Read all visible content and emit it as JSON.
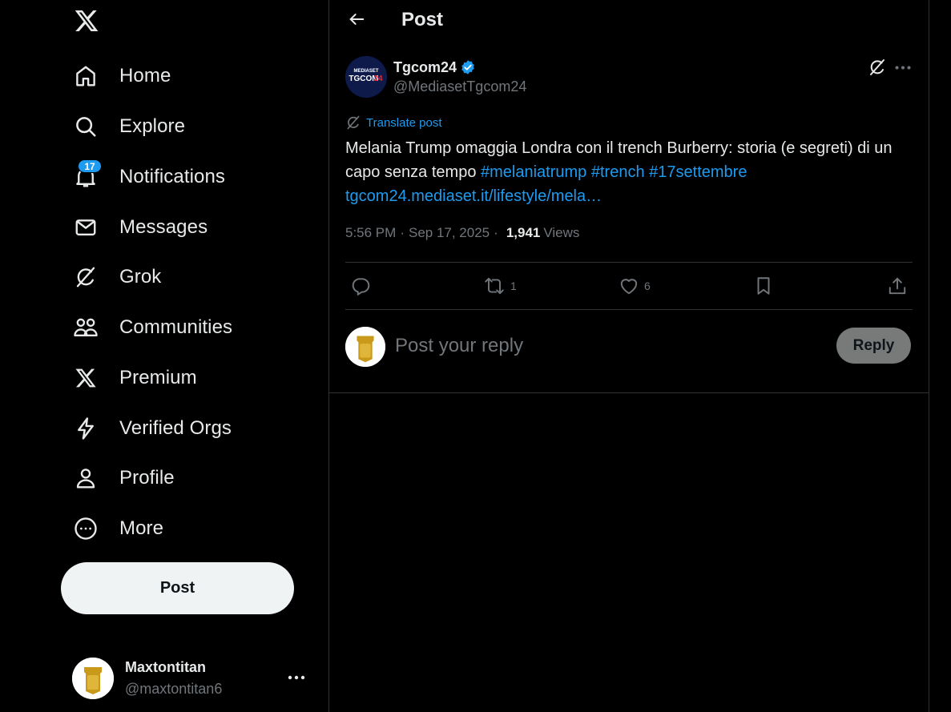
{
  "sidebar": {
    "logo_icon": "x-logo-icon",
    "items": [
      {
        "label": "Home",
        "icon": "home-icon"
      },
      {
        "label": "Explore",
        "icon": "search-icon"
      },
      {
        "label": "Notifications",
        "icon": "bell-icon",
        "badge": "17"
      },
      {
        "label": "Messages",
        "icon": "envelope-icon"
      },
      {
        "label": "Grok",
        "icon": "grok-icon"
      },
      {
        "label": "Communities",
        "icon": "people-icon"
      },
      {
        "label": "Premium",
        "icon": "x-premium-icon"
      },
      {
        "label": "Verified Orgs",
        "icon": "lightning-icon"
      },
      {
        "label": "Profile",
        "icon": "person-icon"
      },
      {
        "label": "More",
        "icon": "more-circle-icon"
      }
    ],
    "post_button": "Post",
    "account": {
      "name": "Maxtontitan",
      "handle": "@maxtontitan6"
    }
  },
  "header": {
    "title": "Post"
  },
  "post": {
    "author_name": "Tgcom24",
    "author_handle": "@MediasetTgcom24",
    "avatar_text_top": "MEDIASET",
    "avatar_text_brand": "TGCOM",
    "avatar_text_num": "24",
    "translate_label": "Translate post",
    "text": "Melania Trump omaggia Londra con il trench Burberry: storia (e segreti) di un capo senza tempo ",
    "hashtags": [
      "#melaniatrump",
      "#trench",
      "#17settembre"
    ],
    "link": "tgcom24.mediaset.it/lifestyle/mela…",
    "time": "5:56 PM",
    "date": "Sep 17, 2025",
    "views_count": "1,941",
    "views_label": "Views",
    "reply_count": "",
    "repost_count": "1",
    "like_count": "6"
  },
  "reply": {
    "placeholder": "Post your reply",
    "button": "Reply"
  },
  "colors": {
    "accent": "#1d9bf0",
    "text": "#e7e9ea",
    "muted": "#71767b",
    "border": "#2f3336",
    "background": "#000000"
  }
}
